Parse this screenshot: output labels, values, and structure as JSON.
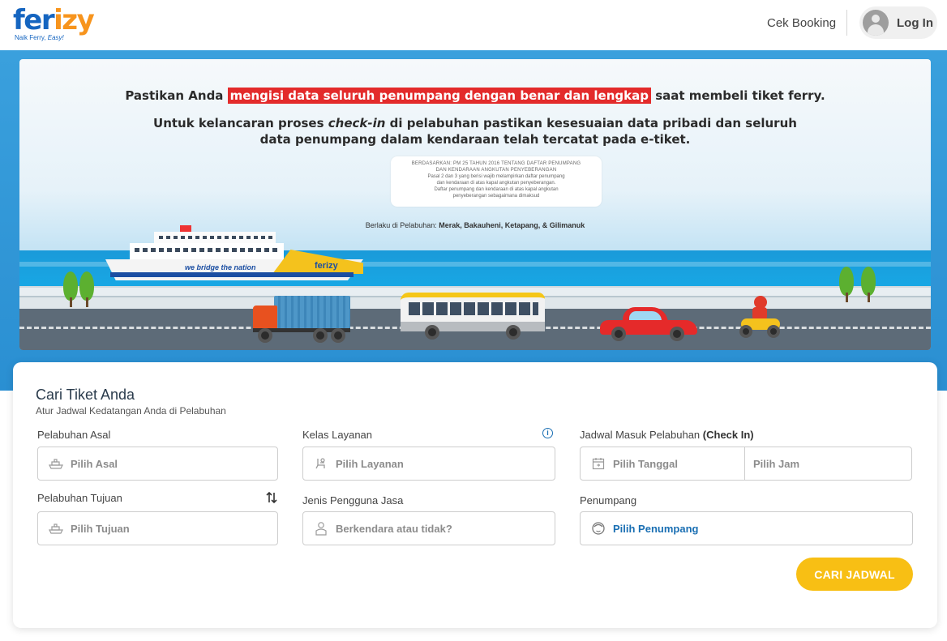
{
  "header": {
    "logo_main_a": "fer",
    "logo_main_b": "izy",
    "logo_tagline_a": "Naik Ferry, ",
    "logo_tagline_b": "Easy!",
    "cek_booking": "Cek Booking",
    "login": "Log In"
  },
  "banner": {
    "line1_pre": "Pastikan Anda ",
    "line1_highlight": "mengisi data seluruh penumpang dengan benar dan lengkap",
    "line1_post": " saat membeli tiket ferry.",
    "line2_a": "Untuk kelancaran proses ",
    "line2_em": "check-in",
    "line2_b": " di pelabuhan pastikan kesesuaian data pribadi dan seluruh",
    "line3": "data penumpang dalam kendaraan telah tercatat pada e-tiket.",
    "reg_title1": "BERDASARKAN: PM 25 TAHUN 2016 TENTANG DAFTAR PENUMPANG",
    "reg_title2": "DAN KENDARAAN ANGKUTAN PENYEBERANGAN",
    "reg_body1": "Pasal 2 dan 3 yang berisi wajib melampirkan daftar penumpang",
    "reg_body2": "dan kendaraan di atas kapal angkutan penyeberangan.",
    "reg_body3": "Daftar penumpang dan kendaraan di atas kapal angkutan",
    "reg_body4": "penyeberangan sebagaimana dimaksud",
    "berlaku_pre": "Berlaku di Pelabuhan: ",
    "berlaku_ports": "Merak, Bakauheni, Ketapang, & Gilimanuk",
    "ferry_slogan": "we bridge the nation",
    "ferry_brand": "ferizy"
  },
  "search": {
    "title": "Cari Tiket Anda",
    "subtitle": "Atur Jadwal Kedatangan Anda di Pelabuhan",
    "origin_label": "Pelabuhan Asal",
    "origin_placeholder": "Pilih Asal",
    "destination_label": "Pelabuhan Tujuan",
    "destination_placeholder": "Pilih Tujuan",
    "class_label": "Kelas Layanan",
    "class_placeholder": "Pilih Layanan",
    "user_type_label": "Jenis Pengguna Jasa",
    "user_type_placeholder": "Berkendara atau tidak?",
    "schedule_label": "Jadwal Masuk Pelabuhan",
    "schedule_label_bold": "(Check In)",
    "date_placeholder": "Pilih Tanggal",
    "time_placeholder": "Pilih Jam",
    "passenger_label": "Penumpang",
    "passenger_placeholder": "Pilih Penumpang",
    "submit": "CARI JADWAL"
  },
  "icons": {
    "origin": "ship-icon",
    "destination": "ship-icon",
    "class": "seat-icon",
    "user_type": "person-icon",
    "date": "calendar-icon",
    "passenger": "passenger-face-icon",
    "info": "info-icon",
    "swap": "swap-vertical-icon"
  },
  "colors": {
    "brand_blue": "#1565c0",
    "brand_orange": "#f7941d",
    "cta_yellow": "#f8bf14",
    "highlight_red": "#e32b2b"
  }
}
